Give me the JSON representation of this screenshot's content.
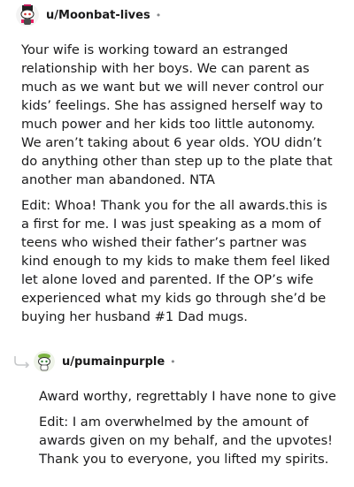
{
  "comment1": {
    "username": "u/Moonbat-lives",
    "separator": "•",
    "paragraphs": [
      "Your wife is working toward an estranged relationship with her boys. We can parent as much as we want but we will never control our kids’ feelings. She has assigned herself way to much power and her kids too little autonomy. We aren’t taking about 6 year olds. YOU didn’t do anything other than step up to the plate that another man abandoned. NTA",
      "Edit: Whoa! Thank you for the all awards.this is a first for me. I was just speaking as a mom of teens who wished their father’s partner was kind enough to my kids to make them feel liked let alone loved and parented. If the OP’s wife experienced what my kids go through she’d be buying her husband #1 Dad mugs."
    ]
  },
  "comment2": {
    "username": "u/pumainpurple",
    "separator": "•",
    "paragraphs": [
      "Award worthy, regrettably I have none to give",
      "Edit: I am overwhelmed by the amount of awards given on my behalf, and the upvotes! Thank you to everyone, you lifted my spirits."
    ]
  },
  "colors": {
    "text": "#1a1a1b",
    "muted": "#878a8c",
    "reply_arrow": "#c6c8ca"
  },
  "icons": {
    "avatar": "snoo-avatar-icon",
    "reply": "reply-arrow-icon"
  }
}
